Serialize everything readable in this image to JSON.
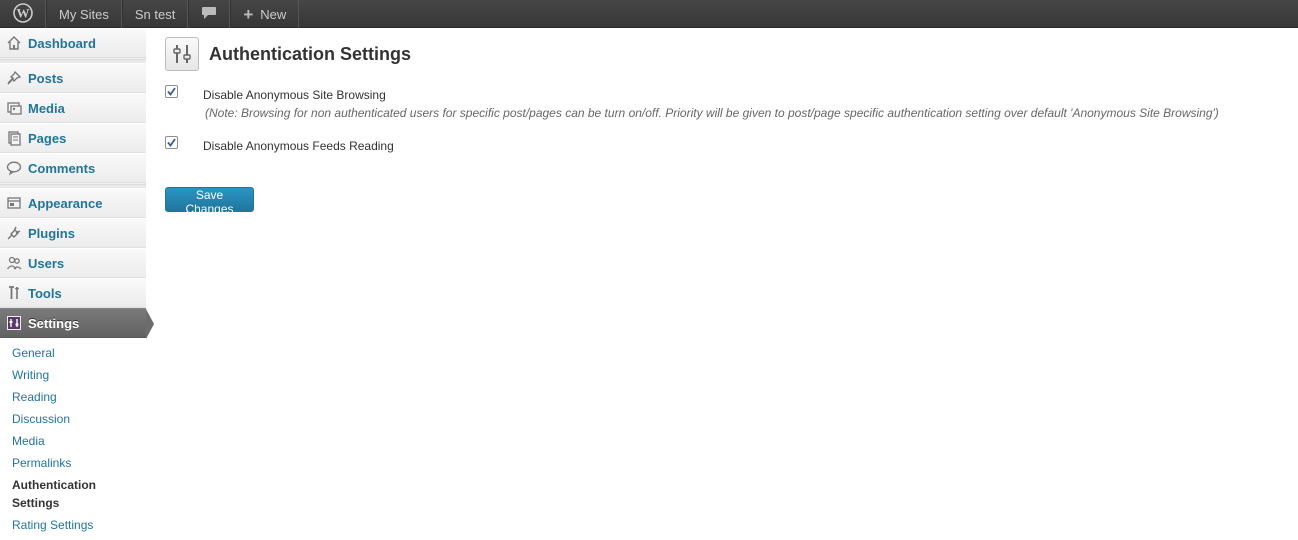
{
  "admin_bar": {
    "wp_logo_icon": "wordpress-logo-icon",
    "my_sites": "My Sites",
    "site_name": "Sn test",
    "comments_icon": "speech-bubble-icon",
    "new_label": "New"
  },
  "sidebar": {
    "items": [
      {
        "label": "Dashboard",
        "icon": "home-icon"
      },
      {
        "label": "Posts",
        "icon": "pushpin-icon"
      },
      {
        "label": "Media",
        "icon": "media-icon"
      },
      {
        "label": "Pages",
        "icon": "pages-icon"
      },
      {
        "label": "Comments",
        "icon": "comment-icon"
      },
      {
        "label": "Appearance",
        "icon": "appearance-icon"
      },
      {
        "label": "Plugins",
        "icon": "plug-icon"
      },
      {
        "label": "Users",
        "icon": "users-icon"
      },
      {
        "label": "Tools",
        "icon": "tools-icon"
      },
      {
        "label": "Settings",
        "icon": "settings-icon"
      }
    ],
    "submenu": [
      {
        "label": "General"
      },
      {
        "label": "Writing"
      },
      {
        "label": "Reading"
      },
      {
        "label": "Discussion"
      },
      {
        "label": "Media"
      },
      {
        "label": "Permalinks"
      },
      {
        "label": "Authentication Settings",
        "current": true
      },
      {
        "label": "Rating Settings"
      }
    ]
  },
  "main": {
    "title": "Authentication Settings",
    "options": [
      {
        "label": "Disable Anonymous Site Browsing",
        "checked": true,
        "note": "(Note: Browsing for non authenticated users for specific post/pages can be turn on/off. Priority will be given to post/page specific authentication setting over default 'Anonymous Site Browsing')"
      },
      {
        "label": "Disable Anonymous Feeds Reading",
        "checked": true
      }
    ],
    "save_label": "Save Changes"
  },
  "colors": {
    "link": "#21759b",
    "admin_bar": "#464646",
    "button": "#21759b"
  }
}
